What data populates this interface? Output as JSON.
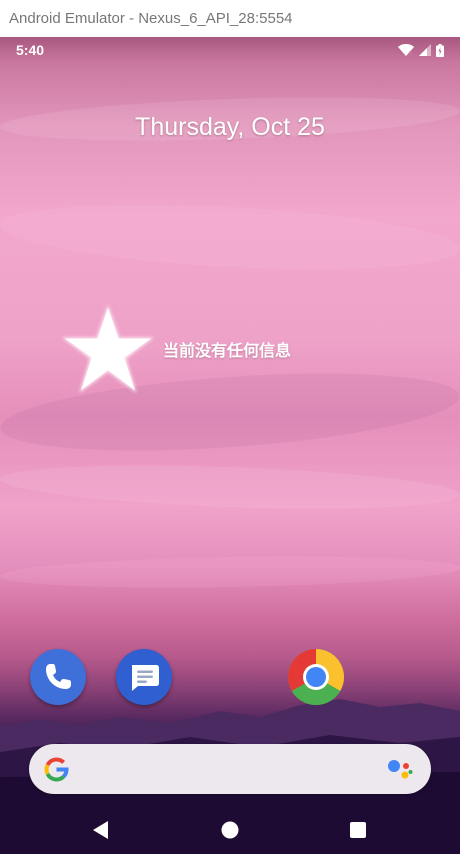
{
  "window": {
    "title": "Android Emulator - Nexus_6_API_28:5554"
  },
  "status_bar": {
    "time": "5:40",
    "icons": [
      "wifi-icon",
      "cell-signal-icon",
      "battery-icon"
    ]
  },
  "lockscreen": {
    "date": "Thursday, Oct 25",
    "notice": "当前没有任何信息",
    "notice_icon": "star-icon"
  },
  "dock": {
    "apps": [
      {
        "name": "Phone",
        "icon": "phone-icon"
      },
      {
        "name": "Messages",
        "icon": "messages-icon"
      },
      {
        "name": "Chrome",
        "icon": "chrome-icon"
      }
    ]
  },
  "search": {
    "left_icon": "google-g-icon",
    "right_icon": "google-assistant-icon"
  },
  "navigation": {
    "buttons": [
      "back-icon",
      "home-icon",
      "recents-icon"
    ]
  },
  "colors": {
    "dock_blue": "#3f6fd8",
    "search_bg": "#ece8ee",
    "sky_pink": "#f2a7cc",
    "night": "#1b0a2e"
  }
}
